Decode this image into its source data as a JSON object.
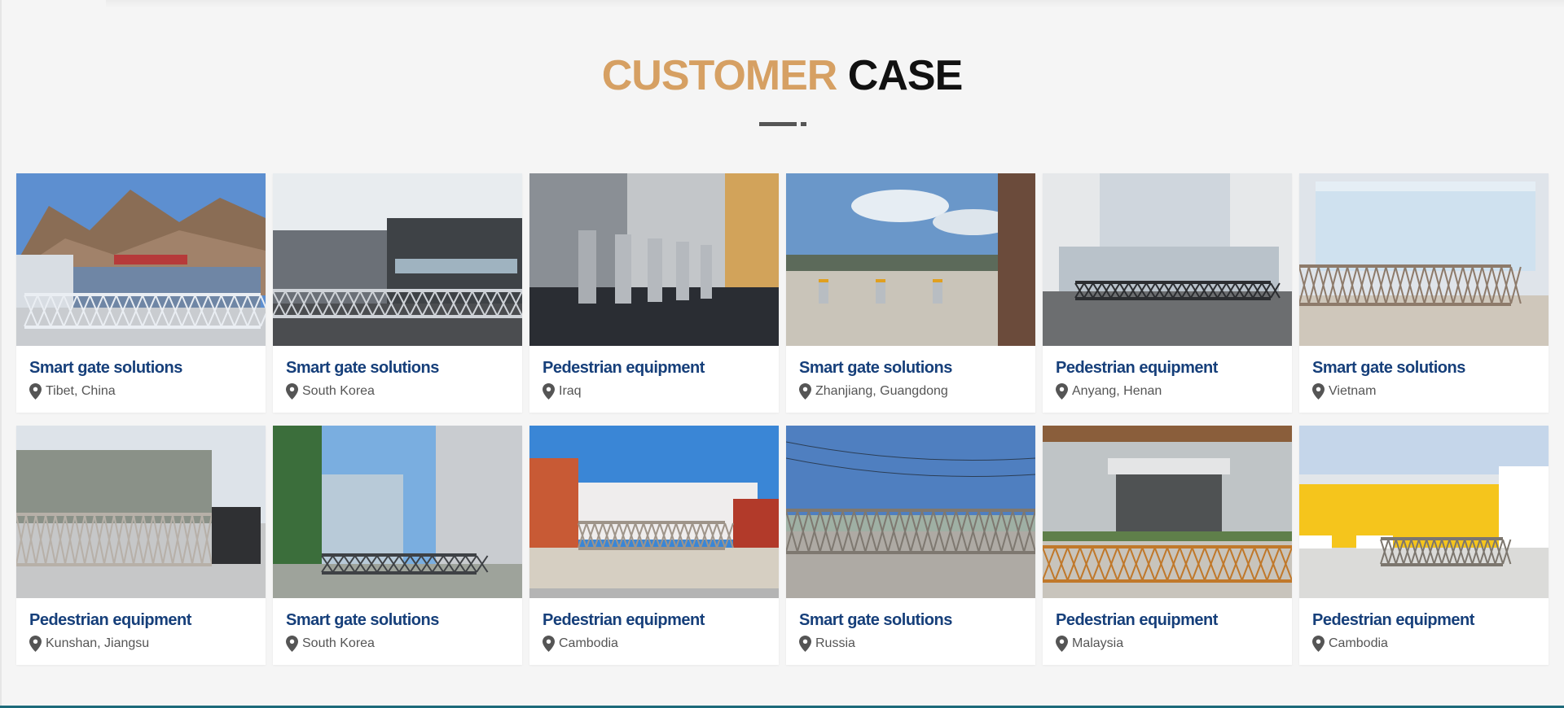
{
  "section": {
    "title_accent": "CUSTOMER",
    "title_dark": "CASE",
    "accent_color": "#d6a063",
    "category_color": "#163f7a"
  },
  "cards": [
    {
      "category": "Smart gate solutions",
      "location": "Tibet, China",
      "scene": "mountain-gate"
    },
    {
      "category": "Smart gate solutions",
      "location": "South Korea",
      "scene": "factory-gate"
    },
    {
      "category": "Pedestrian equipment",
      "location": "Iraq",
      "scene": "turnstile-hall"
    },
    {
      "category": "Smart gate solutions",
      "location": "Zhanjiang, Guangdong",
      "scene": "bollards"
    },
    {
      "category": "Pedestrian equipment",
      "location": "Anyang, Henan",
      "scene": "office-building"
    },
    {
      "category": "Smart gate solutions",
      "location": "Vietnam",
      "scene": "hospital-gate"
    },
    {
      "category": "Pedestrian equipment",
      "location": "Kunshan, Jiangsu",
      "scene": "warehouse-gate"
    },
    {
      "category": "Smart gate solutions",
      "location": "South Korea",
      "scene": "glass-tower-gate"
    },
    {
      "category": "Pedestrian equipment",
      "location": "Cambodia",
      "scene": "factory-orange"
    },
    {
      "category": "Smart gate solutions",
      "location": "Russia",
      "scene": "powerline-gate"
    },
    {
      "category": "Pedestrian equipment",
      "location": "Malaysia",
      "scene": "hotel-entrance"
    },
    {
      "category": "Pedestrian equipment",
      "location": "Cambodia",
      "scene": "yellow-factory"
    }
  ]
}
